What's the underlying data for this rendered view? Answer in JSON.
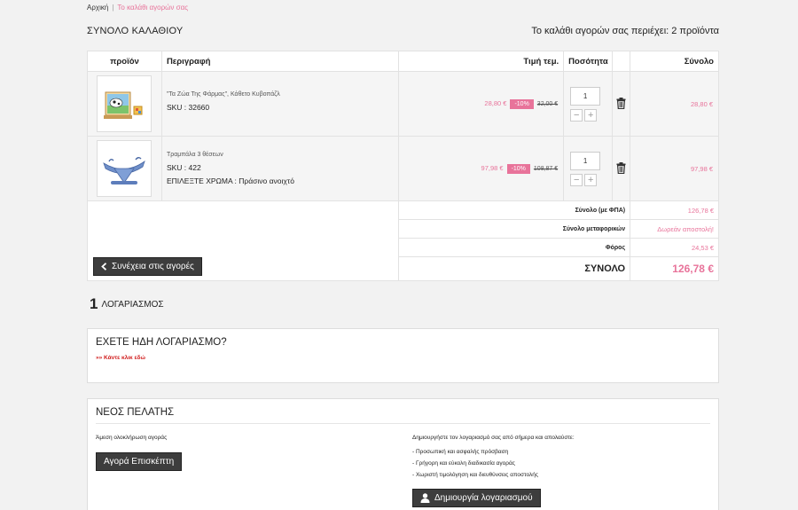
{
  "breadcrumb": {
    "home": "Αρχική",
    "separator": "|",
    "current": "Το καλάθι αγορών σας"
  },
  "cart": {
    "title": "ΣΥΝΟΛΟ ΚΑΛΑΘΙΟΥ",
    "count_text": "Το καλάθι αγορών σας περιέχει: 2 προϊόντα",
    "headers": {
      "product": "προϊόν",
      "description": "Περιγραφή",
      "unit_price": "Τιμή τεμ.",
      "quantity": "Ποσότητα",
      "total": "Σύνολο"
    },
    "items": [
      {
        "name": "\"Τα Ζώα Της Φάρμας\", Κάθετο Κυβοπάζλ",
        "sku": "SKU : 32660",
        "option": "",
        "price": "28,80 €",
        "discount": "-10%",
        "old_price": "32,00 €",
        "qty": "1",
        "total": "28,80 €",
        "thumb_icon": "farm-animals-puzzle-image"
      },
      {
        "name": "Τραμπάλα 3 θέσεων",
        "sku": "SKU : 422",
        "option": "ΕΠΙΛΕΞΤΕ ΧΡΩΜΑ : Πράσινο ανοιχτό",
        "price": "97,98 €",
        "discount": "-10%",
        "old_price": "108,87 €",
        "qty": "1",
        "total": "97,98 €",
        "thumb_icon": "seesaw-image"
      }
    ],
    "qty_minus": "−",
    "qty_plus": "+",
    "summary": [
      {
        "label": "Σύνολο (με ΦΠΑ)",
        "value": "126,78 €"
      },
      {
        "label": "Σύνολο μεταφορικών",
        "value": "Δωρεάν αποστολή!"
      },
      {
        "label": "Φόρος",
        "value": "24,53 €"
      }
    ],
    "grand_label": "ΣΥΝΟΛΟ",
    "grand_value": "126,78 €",
    "continue_label": "Συνέχεια στις αγορές"
  },
  "account": {
    "step_number": "1",
    "step_label": "ΛΟΓΑΡΙΑΣΜΟΣ",
    "existing_title": "ΕΧΕΤΕ ΗΔΗ ΛΟΓΑΡΙΑΣΜΟ?",
    "existing_link": "»» Κάντε κλικ εδώ",
    "new_title": "ΝΕΟΣ ΠΕΛΑΤΗΣ",
    "quick_text": "Άμεση ολοκλήρωση αγοράς",
    "guest_button": "Αγορά Επισκέπτη",
    "create_intro": "Δημιουργήστε τον λογαριασμό σας από σήμερα και απολαύστε:",
    "benefits": [
      "- Προσωπική και ασφαλής πρόσβαση",
      "- Γρήγορη και εύκολη διαδικασία αγοράς",
      "- Χωριστή τιμολόγηση και διευθύνσεις αποστολής"
    ],
    "create_button": "Δημιουργία λογαριασμού"
  },
  "colors": {
    "accent": "#e8739a",
    "dark_button": "#3d3d3d",
    "link_red": "#d01b1b"
  }
}
